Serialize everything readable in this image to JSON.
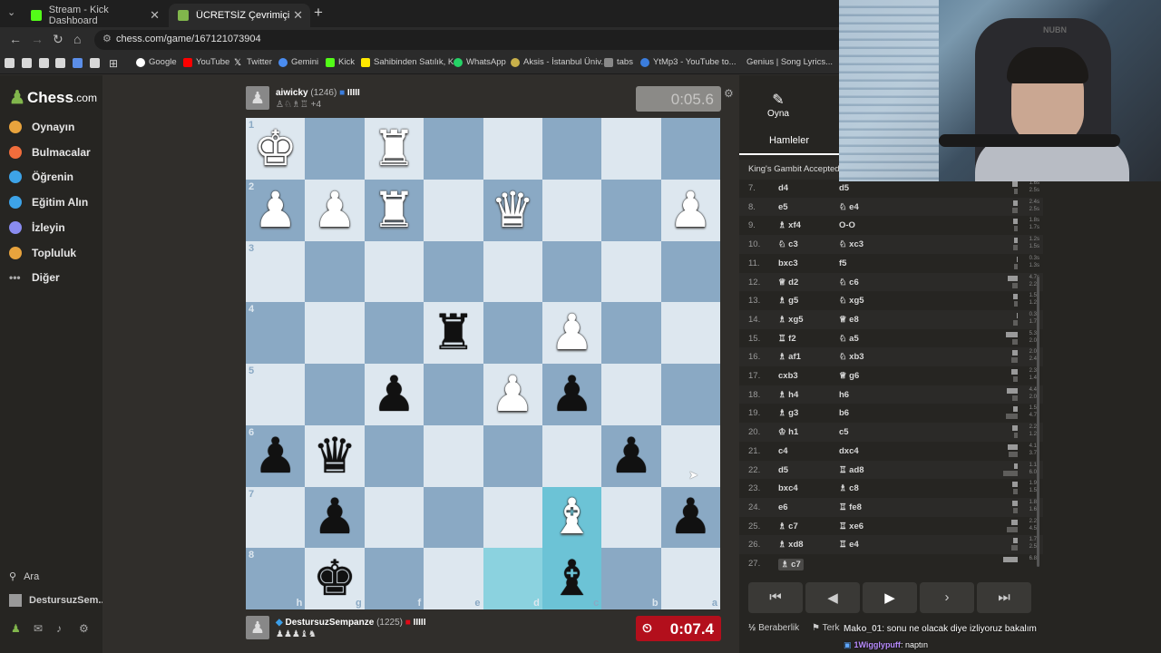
{
  "browser": {
    "tabs": [
      {
        "title": "Stream - Kick Dashboard",
        "color": "#53fc18"
      },
      {
        "title": "ÜCRETSİZ Çevrimiçi Satranç",
        "color": "#81b64c"
      }
    ],
    "url": "chess.com/game/167121073904",
    "bookmarks": [
      "Google",
      "YouTube",
      "Twitter",
      "Gemini",
      "Kick",
      "Sahibinden Satılık, K...",
      "WhatsApp",
      "Aksis - İstanbul Üniv...",
      "tabs",
      "YtMp3 - YouTube to...",
      "Genius | Song Lyrics..."
    ]
  },
  "sidebar": {
    "logo": "Chess",
    "logo_domain": ".com",
    "items": [
      {
        "label": "Oynayın",
        "color": "#e8a33d"
      },
      {
        "label": "Bulmacalar",
        "color": "#f06d3c"
      },
      {
        "label": "Öğrenin",
        "color": "#3da3e8"
      },
      {
        "label": "Eğitim Alın",
        "color": "#3da3e8"
      },
      {
        "label": "İzleyin",
        "color": "#8a8cf0"
      },
      {
        "label": "Topluluk",
        "color": "#e8a33d"
      },
      {
        "label": "Diğer",
        "color": "#aaaaaa"
      }
    ],
    "search": "Ara",
    "user": "DestursuzSem..."
  },
  "game": {
    "top_player": {
      "name": "aiwicky",
      "rating": "(1246)",
      "bars": "IIIII",
      "captured": "+4",
      "clock": "0:05.6"
    },
    "bottom_player": {
      "name": "DestursuzSempanze",
      "rating": "(1225)",
      "bars": "IIIII",
      "clock": "0:07.4"
    },
    "ranks": [
      "1",
      "2",
      "3",
      "4",
      "5",
      "6",
      "7",
      "8"
    ],
    "files": [
      "h",
      "g",
      "f",
      "e",
      "d",
      "c",
      "b",
      "a"
    ],
    "board": [
      [
        "wK",
        "",
        "wR",
        "",
        "",
        "",
        "",
        ""
      ],
      [
        "wP",
        "wP",
        "wR",
        "",
        "wQ",
        "",
        "",
        "wP"
      ],
      [
        "",
        "",
        "",
        "",
        "",
        "",
        "",
        ""
      ],
      [
        "",
        "",
        "",
        "bR",
        "",
        "wP",
        "",
        ""
      ],
      [
        "",
        "",
        "bP",
        "",
        "wP",
        "bP",
        "",
        ""
      ],
      [
        "bP",
        "bQ",
        "",
        "",
        "",
        "",
        "bP",
        ""
      ],
      [
        "",
        "bP",
        "",
        "",
        "",
        "wB",
        "",
        "bP"
      ],
      [
        "",
        "bK",
        "",
        "",
        "",
        "bB",
        "",
        ""
      ]
    ]
  },
  "panel": {
    "play_tab": "Oyna",
    "moves_tab": "Hamleler",
    "opening": "King's Gambit Accepted: F",
    "moves": [
      {
        "no": "7.",
        "w": "d4",
        "b": "d5",
        "t1": "1.6s",
        "t2": "2.5s"
      },
      {
        "no": "8.",
        "w": "e5",
        "b": "♘ e4",
        "t1": "2.4s",
        "t2": "2.5s"
      },
      {
        "no": "9.",
        "w": "♗ xf4",
        "b": "O-O",
        "t1": "1.8s",
        "t2": "1.7s"
      },
      {
        "no": "10.",
        "w": "♘ c3",
        "b": "♘ xc3",
        "t1": "1.2s",
        "t2": "1.5s"
      },
      {
        "no": "11.",
        "w": "bxc3",
        "b": "f5",
        "t1": "0.3s",
        "t2": "1.3s"
      },
      {
        "no": "12.",
        "w": "♕ d2",
        "b": "♘ c6",
        "t1": "4.7s",
        "t2": "2.2s"
      },
      {
        "no": "13.",
        "w": "♗ g5",
        "b": "♘ xg5",
        "t1": "1.5s",
        "t2": "1.2s"
      },
      {
        "no": "14.",
        "w": "♗ xg5",
        "b": "♕ e8",
        "t1": "0.3s",
        "t2": "1.7s"
      },
      {
        "no": "15.",
        "w": "♖ f2",
        "b": "♘ a5",
        "t1": "5.3s",
        "t2": "2.0s"
      },
      {
        "no": "16.",
        "w": "♗ af1",
        "b": "♘ xb3",
        "t1": "2.0s",
        "t2": "2.4s"
      },
      {
        "no": "17.",
        "w": "cxb3",
        "b": "♕ g6",
        "t1": "2.3s",
        "t2": "1.4s"
      },
      {
        "no": "18.",
        "w": "♗ h4",
        "b": "h6",
        "t1": "4.4s",
        "t2": "2.0s"
      },
      {
        "no": "19.",
        "w": "♗ g3",
        "b": "b6",
        "t1": "1.5s",
        "t2": "4.7s"
      },
      {
        "no": "20.",
        "w": "♔ h1",
        "b": "c5",
        "t1": "2.2s",
        "t2": "1.2s"
      },
      {
        "no": "21.",
        "w": "c4",
        "b": "dxc4",
        "t1": "4.1s",
        "t2": "3.7s"
      },
      {
        "no": "22.",
        "w": "d5",
        "b": "♖ ad8",
        "t1": "1.1s",
        "t2": "6.0s"
      },
      {
        "no": "23.",
        "w": "bxc4",
        "b": "♗ c8",
        "t1": "1.9s",
        "t2": "1.5s"
      },
      {
        "no": "24.",
        "w": "e6",
        "b": "♖ fe8",
        "t1": "1.8s",
        "t2": "1.6s"
      },
      {
        "no": "25.",
        "w": "♗ c7",
        "b": "♖ xe6",
        "t1": "2.2s",
        "t2": "4.5s"
      },
      {
        "no": "26.",
        "w": "♗ xd8",
        "b": "♖ e4",
        "t1": "1.7s",
        "t2": "2.5s"
      },
      {
        "no": "27.",
        "w": "♗ c7",
        "b": "",
        "t1": "6.8s",
        "t2": ""
      }
    ],
    "draw": "Beraberlik",
    "resign": "Terk"
  },
  "chat": {
    "line1_user": "Mako_01",
    "line1_msg": ": sonu ne olacak diye izliyoruz bakalım",
    "line2_user": "1Wigglypuff",
    "line2_msg": ": naptın"
  },
  "webcam": {
    "chair_text": "NUBN"
  }
}
